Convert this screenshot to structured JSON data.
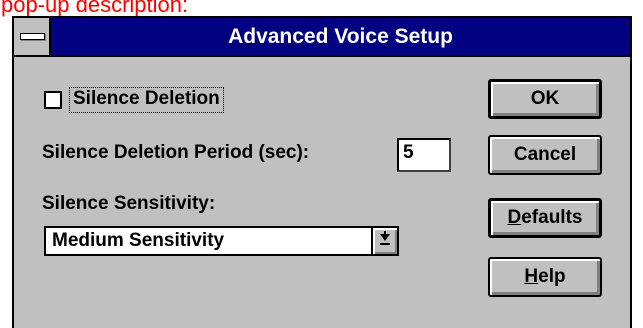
{
  "caption": "pop-up description:",
  "window": {
    "title": "Advanced Voice Setup"
  },
  "silence_deletion": {
    "label": "Silence Deletion",
    "checked": false
  },
  "silence_period": {
    "label": "Silence Deletion Period (sec):",
    "value": "5"
  },
  "sensitivity": {
    "label": "Silence Sensitivity:",
    "selected": "Medium Sensitivity"
  },
  "buttons": {
    "ok": "OK",
    "cancel": "Cancel",
    "defaults_mnemonic": "D",
    "defaults_rest": "efaults",
    "help_mnemonic": "H",
    "help_rest": "elp"
  }
}
